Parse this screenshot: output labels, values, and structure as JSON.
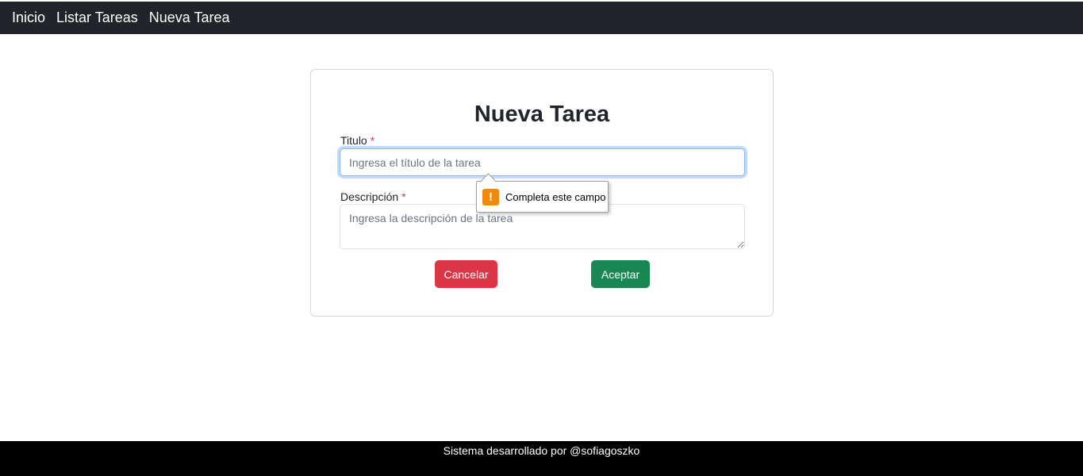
{
  "nav": {
    "items": [
      {
        "label": "Inicio"
      },
      {
        "label": "Listar Tareas"
      },
      {
        "label": "Nueva Tarea"
      }
    ]
  },
  "form": {
    "heading": "Nueva Tarea",
    "title_label": "Titulo",
    "title_required": "*",
    "title_placeholder": "Ingresa el título de la tarea",
    "title_value": "",
    "description_label": "Descripción",
    "description_required": "*",
    "description_placeholder": "Ingresa la descripción de la tarea",
    "description_value": "",
    "cancel_label": "Cancelar",
    "accept_label": "Aceptar"
  },
  "validation_tooltip": {
    "icon": "warning-icon",
    "icon_glyph": "!",
    "message": "Completa este campo"
  },
  "footer": {
    "text": "Sistema desarrollado por @sofiagoszko"
  },
  "colors": {
    "navbar": "#212529",
    "danger": "#dc3545",
    "success": "#198754",
    "warning": "#f0890c",
    "footer": "#000000"
  }
}
